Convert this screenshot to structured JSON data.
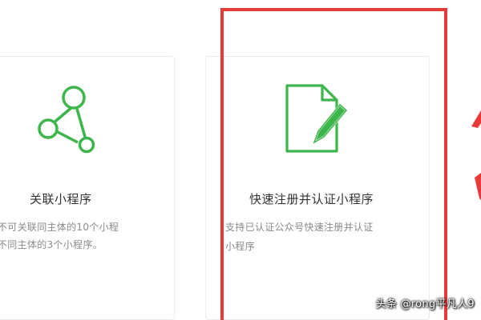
{
  "cards": [
    {
      "id": "link-mini-program",
      "title": "关联小程序",
      "desc_lines": [
        "不可关联同主体的10个小程",
        "不同主体的3个小程序。"
      ],
      "icon": "share-network-icon"
    },
    {
      "id": "quick-register",
      "title": "快速注册并认证小程序",
      "desc_lines": [
        "支持已认证公众号快速注册并认证",
        "小程序"
      ],
      "icon": "document-edit-icon"
    }
  ],
  "watermark": "头条 @rong平凡人9",
  "colors": {
    "icon_green": "#3cb54a",
    "highlight_red": "#e93a3a",
    "title_text": "#333333",
    "desc_text": "#8a8a8a",
    "card_border": "#ececec"
  }
}
